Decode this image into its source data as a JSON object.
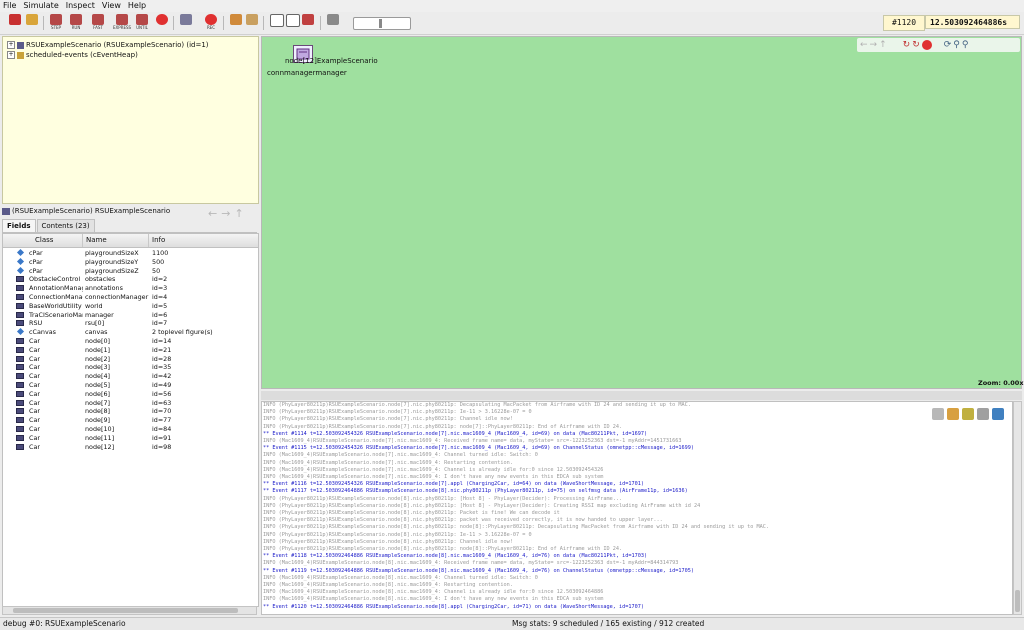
{
  "menu": [
    "File",
    "Simulate",
    "Inspect",
    "View",
    "Help"
  ],
  "toolbar": {
    "buttons": [
      {
        "icon": "load-network-icon",
        "label": ""
      },
      {
        "icon": "open-ini-icon",
        "label": ""
      },
      {
        "icon": "step-icon",
        "label": "STEP"
      },
      {
        "icon": "run-icon",
        "label": "RUN"
      },
      {
        "icon": "fast-run-icon",
        "label": "FAST"
      },
      {
        "icon": "express-run-icon",
        "label": "EXPRESS"
      },
      {
        "icon": "run-until-icon",
        "label": "UNTIL"
      },
      {
        "icon": "stop-icon",
        "label": ""
      },
      {
        "icon": "find-objects-icon",
        "label": ""
      },
      {
        "icon": "record-icon",
        "label": "REC"
      },
      {
        "icon": "network-graph-icon",
        "label": ""
      },
      {
        "icon": "event-log-icon",
        "label": ""
      },
      {
        "icon": "layout-split-icon",
        "label": ""
      },
      {
        "icon": "layout-horizontal-icon",
        "label": ""
      },
      {
        "icon": "layout-toggle-icon",
        "label": ""
      },
      {
        "icon": "preferences-icon",
        "label": ""
      }
    ],
    "event_number": "#1120",
    "sim_time": "12.503092464886s"
  },
  "tree": {
    "items": [
      {
        "label": "RSUExampleScenario (RSUExampleScenario) (id=1)"
      },
      {
        "label": "scheduled-events (cEventHeap)"
      }
    ]
  },
  "inspector": {
    "title": "(RSUExampleScenario) RSUExampleScenario",
    "tabs": [
      "Fields",
      "Contents (23)"
    ],
    "columns": [
      "Class",
      "Name",
      "Info"
    ],
    "rows": [
      {
        "icon": "param",
        "cls": "cPar",
        "name": "playgroundSizeX",
        "info": "1100"
      },
      {
        "icon": "param",
        "cls": "cPar",
        "name": "playgroundSizeY",
        "info": "500"
      },
      {
        "icon": "param",
        "cls": "cPar",
        "name": "playgroundSizeZ",
        "info": "50"
      },
      {
        "icon": "module",
        "cls": "ObstacleControl",
        "name": "obstacles",
        "info": "id=2"
      },
      {
        "icon": "module",
        "cls": "AnnotationManag",
        "name": "annotations",
        "info": "id=3"
      },
      {
        "icon": "module",
        "cls": "ConnectionManag",
        "name": "connectionManager",
        "info": "id=4"
      },
      {
        "icon": "module",
        "cls": "BaseWorldUtility",
        "name": "world",
        "info": "id=5"
      },
      {
        "icon": "module",
        "cls": "TraCIScenarioMar",
        "name": "manager",
        "info": "id=6"
      },
      {
        "icon": "module",
        "cls": "RSU",
        "name": "rsu[0]",
        "info": "id=7"
      },
      {
        "icon": "param",
        "cls": "cCanvas",
        "name": "canvas",
        "info": "2 toplevel figure(s)"
      },
      {
        "icon": "module",
        "cls": "Car",
        "name": "node[0]",
        "info": "id=14"
      },
      {
        "icon": "module",
        "cls": "Car",
        "name": "node[1]",
        "info": "id=21"
      },
      {
        "icon": "module",
        "cls": "Car",
        "name": "node[2]",
        "info": "id=28"
      },
      {
        "icon": "module",
        "cls": "Car",
        "name": "node[3]",
        "info": "id=35"
      },
      {
        "icon": "module",
        "cls": "Car",
        "name": "node[4]",
        "info": "id=42"
      },
      {
        "icon": "module",
        "cls": "Car",
        "name": "node[5]",
        "info": "id=49"
      },
      {
        "icon": "module",
        "cls": "Car",
        "name": "node[6]",
        "info": "id=56"
      },
      {
        "icon": "module",
        "cls": "Car",
        "name": "node[7]",
        "info": "id=63"
      },
      {
        "icon": "module",
        "cls": "Car",
        "name": "node[8]",
        "info": "id=70"
      },
      {
        "icon": "module",
        "cls": "Car",
        "name": "node[9]",
        "info": "id=77"
      },
      {
        "icon": "module",
        "cls": "Car",
        "name": "node[10]",
        "info": "id=84"
      },
      {
        "icon": "module",
        "cls": "Car",
        "name": "node[11]",
        "info": "id=91"
      },
      {
        "icon": "module",
        "cls": "Car",
        "name": "node[12]",
        "info": "id=98"
      }
    ]
  },
  "canvas": {
    "node_label": "node[12]ExampleScenario",
    "node_label2": "connmanagermanager",
    "zoom": "Zoom: 0.00x",
    "bg_color": "#9fe09f"
  },
  "log": [
    {
      "t": "info",
      "x": "INFO (PhyLayer80211p)RSUExampleScenario.node[7].nic.phy80211p: Decapsulating MacPacket from Airframe with ID 24 and sending it up to MAC."
    },
    {
      "t": "info",
      "x": "INFO (PhyLayer80211p)RSUExampleScenario.node[7].nic.phy80211p: Ie-11 > 3.16228e-07 = 0"
    },
    {
      "t": "info",
      "x": "INFO (PhyLayer80211p)RSUExampleScenario.node[7].nic.phy80211p: Channel idle now!"
    },
    {
      "t": "info",
      "x": "INFO (PhyLayer80211p)RSUExampleScenario.node[7].nic.phy80211p: node[7]::PhyLayer80211p: End of Airframe with ID 24."
    },
    {
      "t": "event",
      "x": "** Event #1114   t=12.503092454326   RSUExampleScenario.node[7].nic.mac1609_4 (Mac1609_4, id=69)  on data (Mac80211Pkt, id=1697)"
    },
    {
      "t": "info",
      "x": "INFO (Mac1609_4)RSUExampleScenario.node[7].nic.mac1609_4: Received frame name= data, myState= src=-1223252363 dst=-1 myAddr=1451731663"
    },
    {
      "t": "event",
      "x": "** Event #1115   t=12.503092454326   RSUExampleScenario.node[7].nic.mac1609_4 (Mac1609_4, id=69)  on ChannelStatus (omnetpp::cMessage, id=1699)"
    },
    {
      "t": "info",
      "x": "INFO (Mac1609_4)RSUExampleScenario.node[7].nic.mac1609_4: Channel turned idle: Switch: 0"
    },
    {
      "t": "info",
      "x": "INFO (Mac1609_4)RSUExampleScenario.node[7].nic.mac1609_4: Restarting contention."
    },
    {
      "t": "info",
      "x": "INFO (Mac1609_4)RSUExampleScenario.node[7].nic.mac1609_4: Channel is already idle for:0 since 12.503092454326"
    },
    {
      "t": "info",
      "x": "INFO (Mac1609_4)RSUExampleScenario.node[7].nic.mac1609_4: I don't have any new events in this EDCA sub system"
    },
    {
      "t": "event",
      "x": "** Event #1116   t=12.503092454326   RSUExampleScenario.node[7].appl (Charging2Car, id=64)  on data (WaveShortMessage, id=1701)"
    },
    {
      "t": "event",
      "x": "** Event #1117   t=12.503092464886   RSUExampleScenario.node[8].nic.phy80211p (PhyLayer80211p, id=75)  on selfmsg data (AirFrame11p, id=1636)"
    },
    {
      "t": "info",
      "x": "INFO (PhyLayer80211p)RSUExampleScenario.node[8].nic.phy80211p: [Host 8] - PhyLayer(Decider): Processing AirFrame..."
    },
    {
      "t": "info",
      "x": "INFO (PhyLayer80211p)RSUExampleScenario.node[8].nic.phy80211p: [Host 8] - PhyLayer(Decider): Creating RSSI map excluding AirFrame with id 24"
    },
    {
      "t": "info",
      "x": "INFO (PhyLayer80211p)RSUExampleScenario.node[8].nic.phy80211p: Packet is fine! We can decode it"
    },
    {
      "t": "info",
      "x": "INFO (PhyLayer80211p)RSUExampleScenario.node[8].nic.phy80211p: packet was received correctly, it is now handed to upper layer..."
    },
    {
      "t": "info",
      "x": "INFO (PhyLayer80211p)RSUExampleScenario.node[8].nic.phy80211p: node[8]::PhyLayer80211p: Decapsulating MacPacket from Airframe with ID 24 and sending it up to MAC."
    },
    {
      "t": "info",
      "x": "INFO (PhyLayer80211p)RSUExampleScenario.node[8].nic.phy80211p: Ie-11 > 3.16228e-07 = 0"
    },
    {
      "t": "info",
      "x": "INFO (PhyLayer80211p)RSUExampleScenario.node[8].nic.phy80211p: Channel idle now!"
    },
    {
      "t": "info",
      "x": "INFO (PhyLayer80211p)RSUExampleScenario.node[8].nic.phy80211p: node[8]::PhyLayer80211p: End of Airframe with ID 24."
    },
    {
      "t": "event",
      "x": "** Event #1118   t=12.503092464886   RSUExampleScenario.node[8].nic.mac1609_4 (Mac1609_4, id=76)  on data (Mac80211Pkt, id=1703)"
    },
    {
      "t": "info",
      "x": "INFO (Mac1609_4)RSUExampleScenario.node[8].nic.mac1609_4: Received frame name= data, myState= src=-1223252363 dst=-1 myAddr=844314793"
    },
    {
      "t": "event",
      "x": "** Event #1119   t=12.503092464886   RSUExampleScenario.node[8].nic.mac1609_4 (Mac1609_4, id=76)  on ChannelStatus (omnetpp::cMessage, id=1705)"
    },
    {
      "t": "info",
      "x": "INFO (Mac1609_4)RSUExampleScenario.node[8].nic.mac1609_4: Channel turned idle: Switch: 0"
    },
    {
      "t": "info",
      "x": "INFO (Mac1609_4)RSUExampleScenario.node[8].nic.mac1609_4: Restarting contention."
    },
    {
      "t": "info",
      "x": "INFO (Mac1609_4)RSUExampleScenario.node[8].nic.mac1609_4: Channel is already idle for:0 since 12.503092464886"
    },
    {
      "t": "info",
      "x": "INFO (Mac1609_4)RSUExampleScenario.node[8].nic.mac1609_4: I don't have any new events in this EDCA sub system"
    },
    {
      "t": "event",
      "x": "** Event #1120   t=12.503092464886   RSUExampleScenario.node[8].appl (Charging2Car, id=71)  on data (WaveShortMessage, id=1707)"
    }
  ],
  "status": {
    "left": "debug #0: RSUExampleScenario",
    "right": "Msg stats: 9 scheduled / 165 existing / 912 created"
  }
}
